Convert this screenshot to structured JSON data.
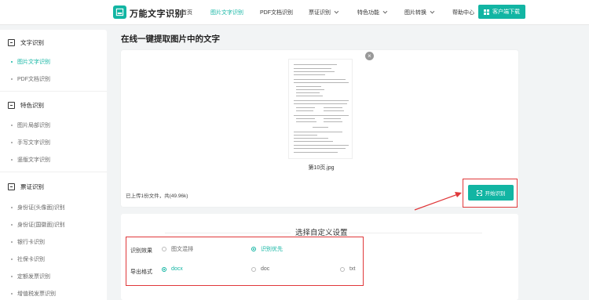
{
  "nav": {
    "brand": "万能文字识别",
    "items": [
      {
        "label": "首页",
        "active": false,
        "caret": false
      },
      {
        "label": "图片文字识别",
        "active": true,
        "caret": false
      },
      {
        "label": "PDF文档识别",
        "active": false,
        "caret": false
      },
      {
        "label": "票证识别",
        "active": false,
        "caret": true
      },
      {
        "label": "特色功能",
        "active": false,
        "caret": true
      },
      {
        "label": "图片转换",
        "active": false,
        "caret": true
      },
      {
        "label": "帮助中心",
        "active": false,
        "caret": false
      }
    ],
    "download_label": "客户端下载"
  },
  "sidebar": {
    "sections": [
      {
        "title": "文字识别",
        "icon": "text-scan-icon",
        "items": [
          {
            "label": "图片文字识别",
            "active": true
          },
          {
            "label": "PDF文档识别",
            "active": false
          }
        ]
      },
      {
        "title": "特色识别",
        "icon": "feature-scan-icon",
        "items": [
          {
            "label": "图片局部识别",
            "active": false
          },
          {
            "label": "手写文字识别",
            "active": false
          },
          {
            "label": "竖版文字识别",
            "active": false
          }
        ]
      },
      {
        "title": "票证识别",
        "icon": "ticket-scan-icon",
        "items": [
          {
            "label": "身份证(头像面)识别",
            "active": false
          },
          {
            "label": "身份证(国徽面)识别",
            "active": false
          },
          {
            "label": "银行卡识别",
            "active": false
          },
          {
            "label": "社保卡识别",
            "active": false
          },
          {
            "label": "定额发票识别",
            "active": false
          },
          {
            "label": "增值税发票识别",
            "active": false
          }
        ]
      }
    ]
  },
  "main": {
    "title": "在线一键提取图片中的文字",
    "file_name": "第10页.jpg",
    "upload_info": "已上传1份文件，共(49.96k)",
    "start_label": "开始识别",
    "settings": {
      "title": "选择自定义设置",
      "effect_label": "识别效果",
      "effect_options": [
        {
          "label": "图文混排",
          "checked": false
        },
        {
          "label": "识别优先",
          "checked": true
        }
      ],
      "format_label": "导出格式",
      "format_options": [
        {
          "label": "docx",
          "checked": true
        },
        {
          "label": "doc",
          "checked": false
        },
        {
          "label": "txt",
          "checked": false
        }
      ]
    }
  },
  "colors": {
    "accent": "#12b5a3",
    "highlight": "#e0383a"
  }
}
